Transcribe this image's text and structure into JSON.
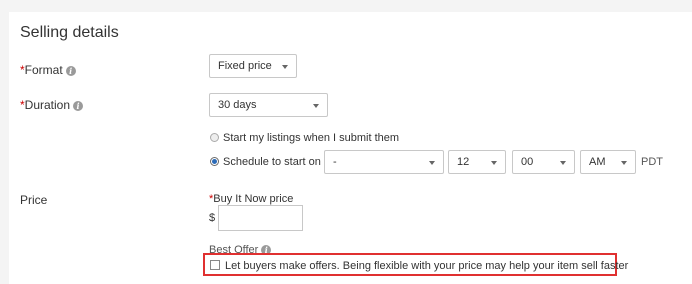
{
  "section": {
    "title": "Selling details"
  },
  "format": {
    "label": "Format",
    "required_mark": "*",
    "selected": "Fixed price"
  },
  "duration": {
    "label": "Duration",
    "required_mark": "*",
    "selected": "30 days",
    "start_now_label": "Start my listings when I submit them",
    "schedule_label": "Schedule to start on",
    "schedule_date": "-",
    "schedule_hour": "12",
    "schedule_minute": "00",
    "schedule_ampm": "AM",
    "timezone": "PDT"
  },
  "price": {
    "label": "Price",
    "buy_it_now_required_mark": "*",
    "buy_it_now_label": "Buy It Now price",
    "currency_symbol": "$",
    "buy_it_now_value": "",
    "best_offer_label": "Best Offer",
    "best_offer_checkbox_label": "Let buyers make offers. Being flexible with your price may help your item sell faster"
  },
  "icons": {
    "info": "info-icon"
  },
  "colors": {
    "required": "#cc0000",
    "highlight_border": "#e03030",
    "radio_selected": "#2c6bb8"
  }
}
